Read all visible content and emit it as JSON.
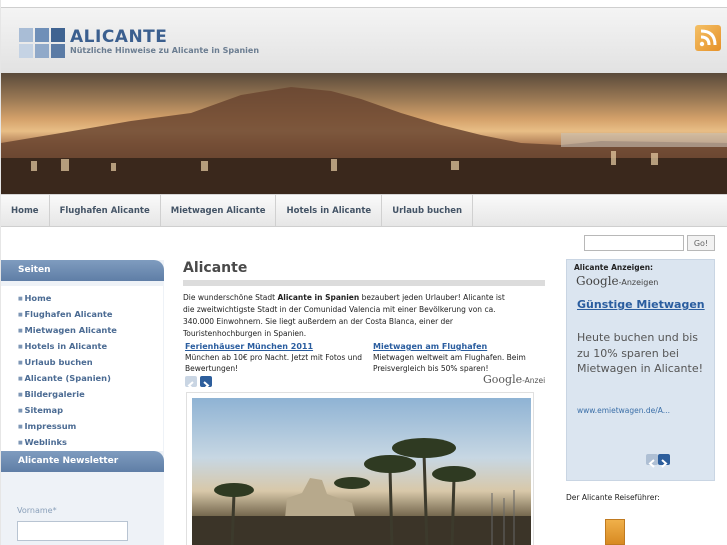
{
  "header": {
    "title": "ALICANTE",
    "subtitle": "Nützliche Hinweise zu Alicante in Spanien"
  },
  "nav": {
    "items": [
      "Home",
      "Flughafen Alicante",
      "Mietwagen Alicante",
      "Hotels in Alicante",
      "Urlaub buchen"
    ]
  },
  "search": {
    "button_label": "Go!",
    "value": ""
  },
  "sidebar": {
    "pages_heading": "Seiten",
    "links": [
      "Home",
      "Flughafen Alicante",
      "Mietwagen Alicante",
      "Hotels in Alicante",
      "Urlaub buchen",
      "Alicante (Spanien)",
      "Bildergalerie",
      "Sitemap",
      "Impressum",
      "Weblinks"
    ],
    "newsletter_heading": "Alicante Newsletter",
    "newsletter_field_label": "Vorname*"
  },
  "content": {
    "title": "Alicante",
    "intro_1": "Die wunderschöne Stadt ",
    "intro_bold": "Alicante in Spanien",
    "intro_2": " bezaubert jeden Urlauber! Alicante ist die zweitwichtigste Stadt in der Comunidad Valencia mit einer Bevölkerung von ca. 340.000 Einwohnern. Sie liegt außerdem an der Costa Blanca, einer der Touristenhochburgen in Spanien.",
    "ads": [
      {
        "title": "Ferienhäuser München 2011",
        "text": "München ab 10€ pro Nacht. Jetzt mit Fotos und Bewertungen!"
      },
      {
        "title": "Mietwagen am Flughafen",
        "text": "Mietwagen weltweit am Flughafen. Beim Preisvergleich bis 50% sparen!"
      }
    ],
    "google_brand": "Google",
    "google_suffix": "-Anzei"
  },
  "right_ad": {
    "heading": "Alicante Anzeigen:",
    "google_brand": "Google",
    "google_suffix": "-Anzeigen",
    "title": "Günstige Mietwagen",
    "text": "Heute buchen und bis zu 10% sparen bei Mietwagen in Alicante!",
    "url": "www.emietwagen.de/A..."
  },
  "guide": {
    "label": "Der Alicante Reiseführer:"
  },
  "colors": {
    "accent": "#5f7ea6",
    "link": "#2a5d9f",
    "rss": "#e69128"
  },
  "icons": [
    "logo-icon",
    "rss-icon",
    "prev-arrow-icon",
    "next-arrow-icon"
  ]
}
